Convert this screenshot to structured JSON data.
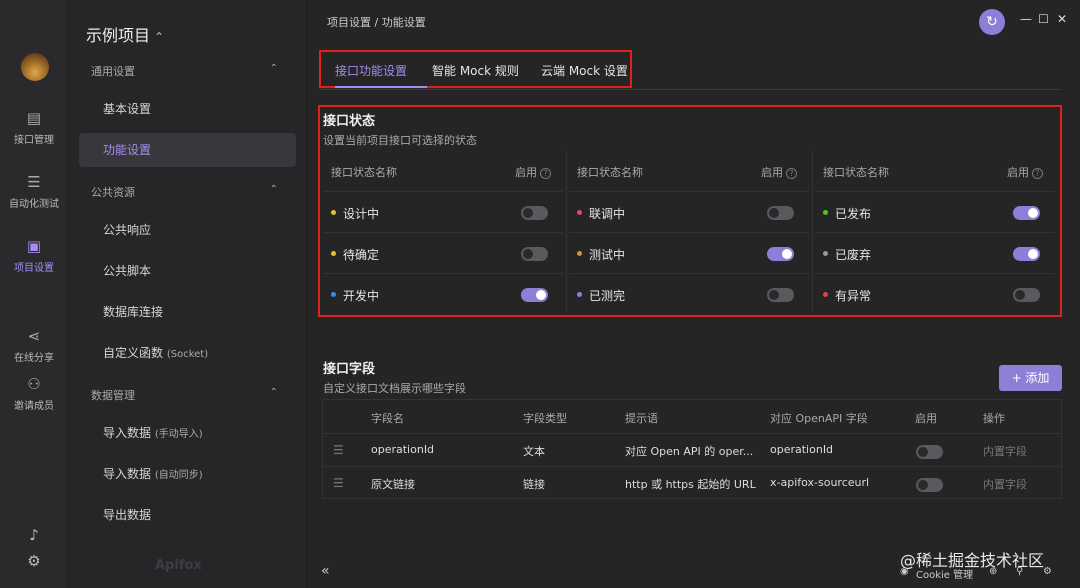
{
  "rail": {
    "items": [
      {
        "label": "接口管理",
        "icon": "api-doc-icon"
      },
      {
        "label": "自动化测试",
        "icon": "auto-test-icon"
      },
      {
        "label": "项目设置",
        "icon": "project-settings-icon",
        "active": true
      },
      {
        "label": "在线分享",
        "icon": "share-icon"
      },
      {
        "label": "邀请成员",
        "icon": "invite-member-icon"
      }
    ],
    "bottom_icons": [
      "bell-icon",
      "gear-icon"
    ]
  },
  "sidebar": {
    "project_title": "示例项目",
    "project_switch_glyph": "⌃",
    "groups": [
      {
        "label": "通用设置",
        "chev": "⌃",
        "items": [
          {
            "label": "基本设置"
          },
          {
            "label": "功能设置",
            "active": true
          }
        ]
      },
      {
        "label": "公共资源",
        "chev": "⌃",
        "items": [
          {
            "label": "公共响应"
          },
          {
            "label": "公共脚本"
          },
          {
            "label": "数据库连接"
          },
          {
            "label": "自定义函数",
            "sub": "(Socket)"
          }
        ]
      },
      {
        "label": "数据管理",
        "chev": "⌃",
        "items": [
          {
            "label": "导入数据",
            "sub": "(手动导入)"
          },
          {
            "label": "导入数据",
            "sub": "(自动同步)"
          },
          {
            "label": "导出数据"
          }
        ]
      }
    ],
    "watermark": "Apifox"
  },
  "header": {
    "breadcrumb": "项目设置  /  功能设置",
    "sync_icon": "↻",
    "window_controls": [
      "—",
      "☐",
      "✕"
    ]
  },
  "tabs": [
    {
      "label": "接口功能设置",
      "active": true
    },
    {
      "label": "智能 Mock 规则"
    },
    {
      "label": "云端 Mock 设置"
    }
  ],
  "status_section": {
    "title": "接口状态",
    "description": "设置当前项目接口可选择的状态",
    "col_name": "接口状态名称",
    "col_enable": "启用",
    "help_glyph": "?",
    "columns": [
      [
        {
          "label": "设计中",
          "dot": "#e5c02e",
          "on": false
        },
        {
          "label": "待确定",
          "dot": "#e5c02e",
          "on": false
        },
        {
          "label": "开发中",
          "dot": "#3a8ee6",
          "on": true
        }
      ],
      [
        {
          "label": "联调中",
          "dot": "#e0457b",
          "on": false
        },
        {
          "label": "测试中",
          "dot": "#e08a3a",
          "on": true
        },
        {
          "label": "已测完",
          "dot": "#9a7ce0",
          "on": false
        }
      ],
      [
        {
          "label": "已发布",
          "dot": "#52c41a",
          "on": true
        },
        {
          "label": "已废弃",
          "dot": "#999999",
          "on": true
        },
        {
          "label": "有异常",
          "dot": "#e04545",
          "on": false
        }
      ]
    ]
  },
  "fields_section": {
    "title": "接口字段",
    "description": "自定义接口文档展示哪些字段",
    "add_label": "+ 添加",
    "headers": [
      "字段名",
      "字段类型",
      "提示语",
      "对应 OpenAPI 字段",
      "启用",
      "操作"
    ],
    "rows": [
      {
        "name": "operationId",
        "type": "文本",
        "hint": "对应 Open API 的 oper...",
        "openapi": "operationId",
        "on": false,
        "op": "内置字段"
      },
      {
        "name": "原文链接",
        "type": "链接",
        "hint": "http 或 https 起始的 URL",
        "openapi": "x-apifox-sourceurl",
        "on": false,
        "op": "内置字段"
      }
    ]
  },
  "footer": {
    "collapse": "«",
    "cookie": "Cookie 管理",
    "icons": [
      "help-circle-icon",
      "shirt-icon",
      "settings-icon"
    ],
    "watermark": "@稀土掘金技术社区"
  }
}
